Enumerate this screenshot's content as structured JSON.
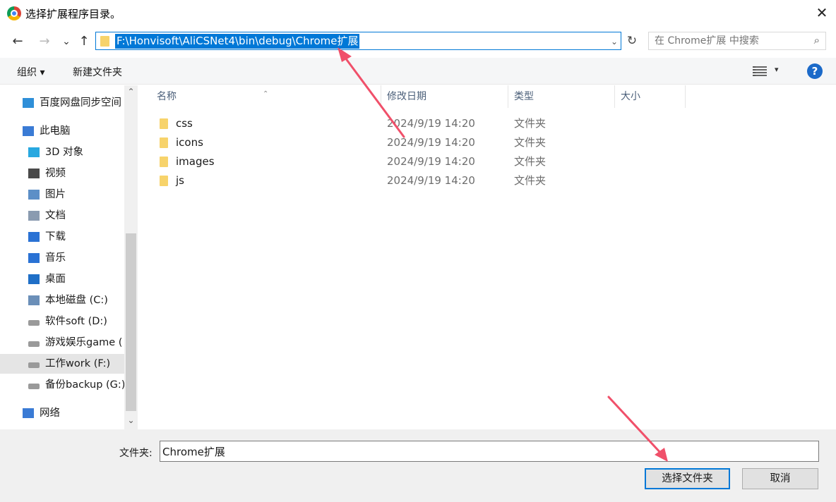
{
  "window": {
    "title": "选择扩展程序目录。",
    "close_symbol": "✕"
  },
  "nav": {
    "back_symbol": "←",
    "forward_symbol": "→",
    "recent_symbol": "⌄",
    "up_symbol": "↑",
    "address": "F:\\Honvisoft\\AliCSNet4\\bin\\debug\\Chrome扩展",
    "address_dropdown": "⌄",
    "refresh_symbol": "↻",
    "search_placeholder": "在 Chrome扩展 中搜索",
    "search_symbol": "⌕"
  },
  "toolbar": {
    "organize": "组织 ▾",
    "new_folder": "新建文件夹",
    "view_dropdown": "▾",
    "help": "?"
  },
  "sidebar": {
    "items": [
      {
        "label": "百度网盘同步空间",
        "icon": "cloud-sync-icon",
        "color": "#2f8fd8"
      },
      {
        "label": "此电脑",
        "icon": "computer-icon",
        "color": "#3a7bd5"
      },
      {
        "label": "3D 对象",
        "icon": "cube-icon",
        "color": "#28a8e0"
      },
      {
        "label": "视频",
        "icon": "film-icon",
        "color": "#4a4a4a"
      },
      {
        "label": "图片",
        "icon": "picture-icon",
        "color": "#5c8fc7"
      },
      {
        "label": "文档",
        "icon": "document-icon",
        "color": "#8a9bb0"
      },
      {
        "label": "下载",
        "icon": "download-icon",
        "color": "#2a72d4"
      },
      {
        "label": "音乐",
        "icon": "music-icon",
        "color": "#2a72d4"
      },
      {
        "label": "桌面",
        "icon": "desktop-icon",
        "color": "#1f6fc7"
      },
      {
        "label": "本地磁盘 (C:)",
        "icon": "system-drive-icon",
        "color": "#6b8fb8"
      },
      {
        "label": "软件soft (D:)",
        "icon": "drive-icon",
        "color": "#9a9a9a"
      },
      {
        "label": "游戏娱乐game (",
        "icon": "drive-icon",
        "color": "#9a9a9a"
      },
      {
        "label": "工作work (F:)",
        "icon": "drive-icon",
        "color": "#9a9a9a",
        "selected": true
      },
      {
        "label": "备份backup (G:)",
        "icon": "drive-icon",
        "color": "#9a9a9a"
      },
      {
        "label": "网络",
        "icon": "network-icon",
        "color": "#3a7bd5"
      }
    ],
    "scroll_up": "⌃",
    "scroll_down": "⌄"
  },
  "columns": {
    "name": "名称",
    "modified": "修改日期",
    "type": "类型",
    "size": "大小",
    "sort_indicator": "⌃"
  },
  "files": [
    {
      "name": "css",
      "modified": "2024/9/19 14:20",
      "type": "文件夹"
    },
    {
      "name": "icons",
      "modified": "2024/9/19 14:20",
      "type": "文件夹"
    },
    {
      "name": "images",
      "modified": "2024/9/19 14:20",
      "type": "文件夹"
    },
    {
      "name": "js",
      "modified": "2024/9/19 14:20",
      "type": "文件夹"
    }
  ],
  "footer": {
    "folder_label": "文件夹:",
    "folder_value": "Chrome扩展",
    "select_button": "选择文件夹",
    "cancel_button": "取消"
  },
  "colors": {
    "accent": "#0078d7",
    "annotation_arrow": "#f0506a",
    "folder": "#f7d36b"
  }
}
